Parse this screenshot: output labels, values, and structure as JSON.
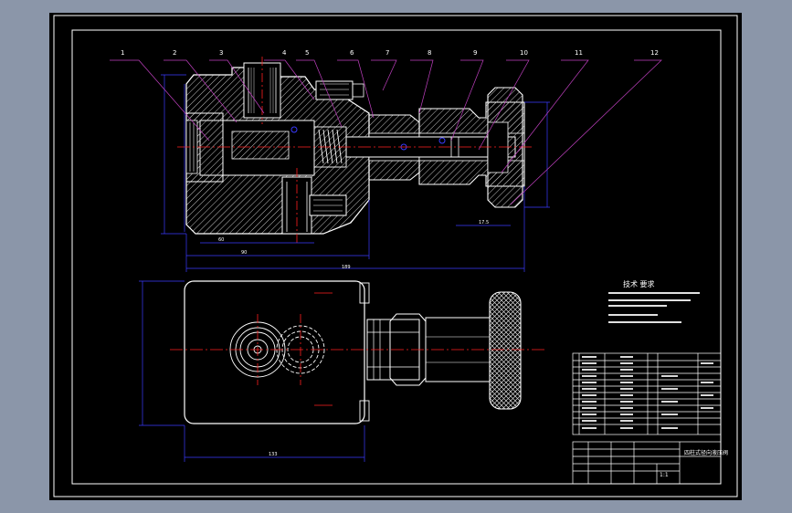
{
  "balloons": [
    "1",
    "2",
    "3",
    "4",
    "5",
    "6",
    "7",
    "8",
    "9",
    "10",
    "11",
    "12"
  ],
  "tech_title": "技术 要求",
  "dims": {
    "overall": "189",
    "part_a": "60",
    "part_b": "90",
    "stem": "17.5",
    "width": "133"
  },
  "title_block": {
    "name": "四柱式径向液压阀",
    "scale": "1:1"
  },
  "colors": {
    "sheet": "#000000",
    "frame": "#ffffff",
    "part": "#ffffff",
    "hatch": "#c4c4c4",
    "dimension": "#3a3aff",
    "centerline": "#ff2020",
    "leader": "#c040c0"
  }
}
